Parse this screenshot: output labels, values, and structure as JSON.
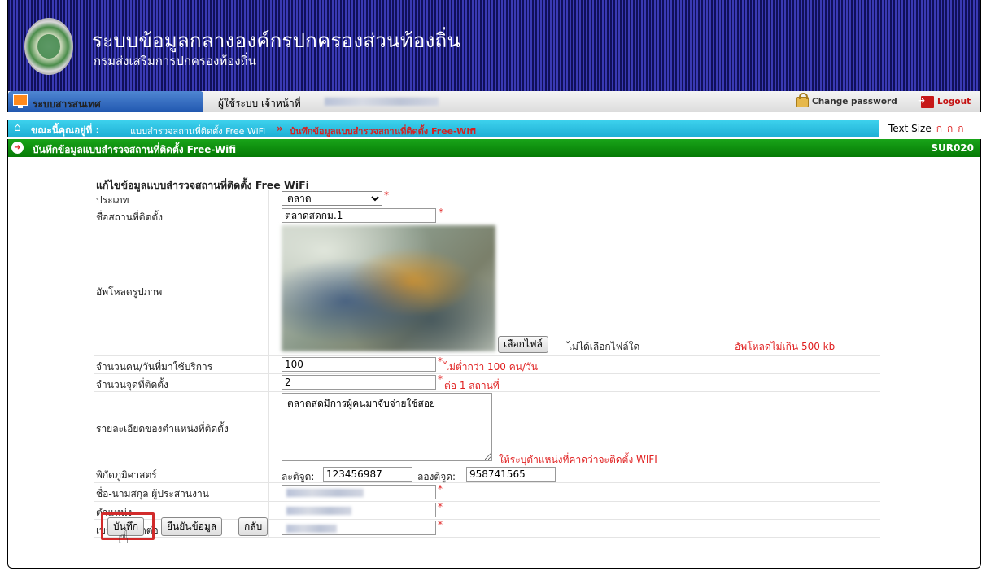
{
  "header": {
    "title": "ระบบข้อมูลกลางองค์กรปกครองส่วนท้องถิ่น",
    "subtitle": "กรมส่งเสริมการปกครองท้องถิ่น"
  },
  "userbar": {
    "system_tab": "ระบบสารสนเทศ",
    "user_label": "ผู้ใช้ระบบ เจ้าหน้าที่",
    "change_password": "Change password",
    "logout": "Logout"
  },
  "breadcrumb": {
    "label": "ขณะนี้คุณอยู่ที่ :",
    "item1": "แบบสำรวจสถานที่ติดตั้ง Free WiFi",
    "separator": "»",
    "item2": "บันทึกข้อมูลแบบสำรวจสถานที่ติดตั้ง Free-Wifi",
    "text_size_label": "Text Size",
    "text_size_options": [
      "ก",
      "ก",
      "ก"
    ]
  },
  "section": {
    "title": "บันทึกข้อมูลแบบสำรวจสถานที่ติดตั้ง Free-Wifi",
    "code": "SUR020"
  },
  "form": {
    "heading": "แก้ไขข้อมูลแบบสำรวจสถานที่ติดตั้ง Free WiFi",
    "required_mark": "*",
    "type": {
      "label": "ประเภท",
      "value": "ตลาด"
    },
    "place_name": {
      "label": "ชื่อสถานที่ติดตั้ง",
      "value": "ตลาดสดกม.1"
    },
    "upload": {
      "label": "อัพโหลดรูปภาพ",
      "button": "เลือกไฟล์",
      "status": "ไม่ได้เลือกไฟล์ใด",
      "note": "อัพโหลดไม่เกิน 500 kb"
    },
    "people_per_day": {
      "label": "จำนวนคน/วันที่มาใช้บริการ",
      "value": "100",
      "note": "ไม่ต่ำกว่า 100 คน/วัน"
    },
    "points": {
      "label": "จำนวนจุดที่ติดตั้ง",
      "value": "2",
      "note": "ต่อ 1 สถานที่"
    },
    "location_detail": {
      "label": "รายละเอียดของตำแหน่งที่ติดตั้ง",
      "value": "ตลาดสดมีการผู้คนมาจับจ่ายใช้สอย",
      "note": "ให้ระบุตำแหน่งที่คาดว่าจะติดตั้ง WIFI"
    },
    "geo": {
      "label": "พิกัดภูมิศาสตร์",
      "lat_label": "ละติจูด:",
      "lat_value": "123456987",
      "lon_label": "ลองติจูด:",
      "lon_value": "958741565"
    },
    "coordinator": {
      "label": "ชื่อ-นามสกุล ผู้ประสานงาน"
    },
    "position": {
      "label": "ตำแหน่ง"
    },
    "phone": {
      "label": "เบอร์โทรติดต่อ"
    }
  },
  "buttons": {
    "save": "บันทึก",
    "confirm": "ยืนยันข้อมูล",
    "back": "กลับ"
  }
}
